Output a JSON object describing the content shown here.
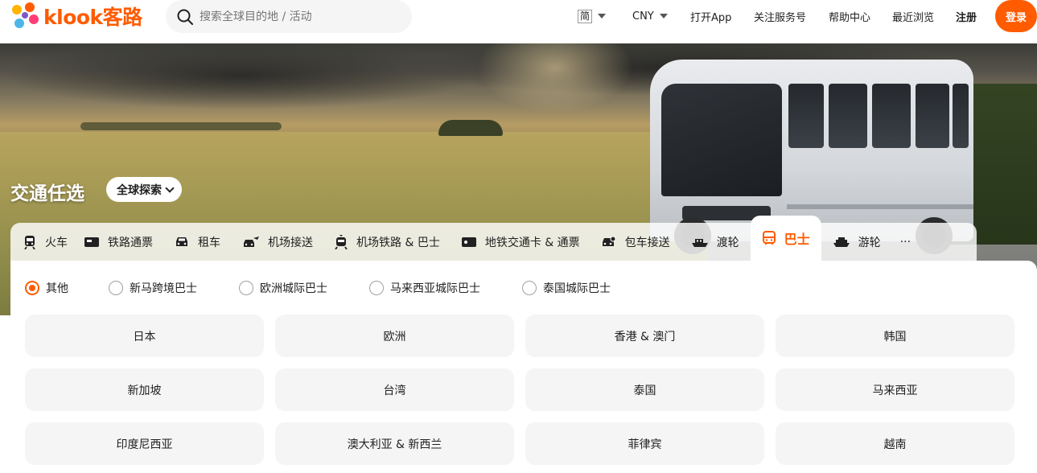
{
  "brand": {
    "name": "klook客路",
    "accent": "#ff5b00"
  },
  "search": {
    "placeholder": "搜索全球目的地 / 活动"
  },
  "nav": {
    "language": "简",
    "currency": "CNY",
    "open_app": "打开App",
    "follow": "关注服务号",
    "help": "帮助中心",
    "recent": "最近浏览",
    "register": "注册",
    "login": "登录"
  },
  "hero": {
    "title": "交通任选",
    "explore": "全球探索"
  },
  "categories": [
    {
      "label": "火车",
      "icon": "train-icon"
    },
    {
      "label": "铁路通票",
      "icon": "rail-pass-icon"
    },
    {
      "label": "租车",
      "icon": "car-icon"
    },
    {
      "label": "机场接送",
      "icon": "airport-transfer-icon"
    },
    {
      "label": "机场铁路 & 巴士",
      "icon": "airport-rail-icon"
    },
    {
      "label": "地铁交通卡 & 通票",
      "icon": "metro-card-icon"
    },
    {
      "label": "包车接送",
      "icon": "charter-car-icon"
    },
    {
      "label": "渡轮",
      "icon": "ferry-icon"
    },
    {
      "label": "巴士",
      "icon": "bus-icon",
      "active": true
    },
    {
      "label": "游轮",
      "icon": "cruise-icon"
    },
    {
      "label": "···",
      "icon": "more-icon"
    }
  ],
  "filters": [
    {
      "label": "其他",
      "checked": true
    },
    {
      "label": "新马跨境巴士"
    },
    {
      "label": "欧洲城际巴士"
    },
    {
      "label": "马来西亚城际巴士"
    },
    {
      "label": "泰国城际巴士"
    }
  ],
  "destinations": [
    "日本",
    "欧洲",
    "香港 & 澳门",
    "韩国",
    "新加坡",
    "台湾",
    "泰国",
    "马来西亚",
    "印度尼西亚",
    "澳大利亚 & 新西兰",
    "菲律宾",
    "越南"
  ]
}
